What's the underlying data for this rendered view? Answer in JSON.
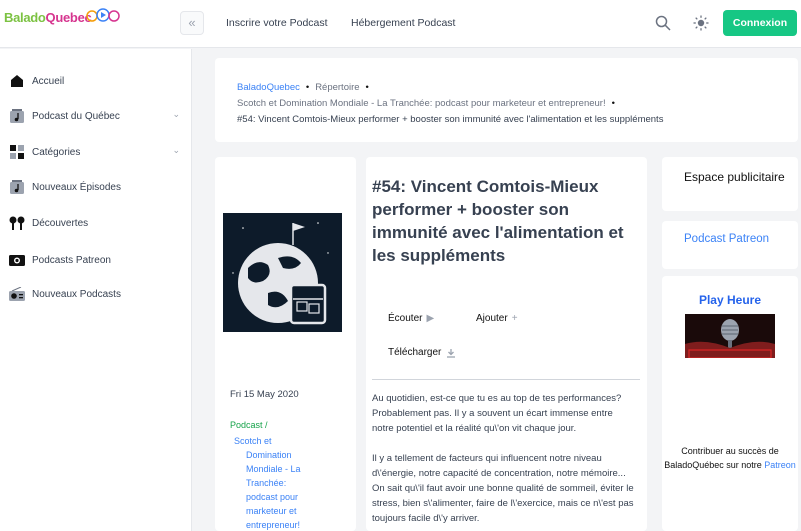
{
  "header": {
    "logo_part1": "Balado",
    "logo_part2": "Quebec",
    "nav_links": [
      "Inscrire votre Podcast",
      "Hébergement Podcast"
    ],
    "login_label": "Connexion"
  },
  "sidebar": {
    "items": [
      {
        "label": "Accueil",
        "icon": "home-icon"
      },
      {
        "label": "Podcast du Québec",
        "icon": "music-note-icon",
        "has_chevron": true
      },
      {
        "label": "Catégories",
        "icon": "grid-icon",
        "has_chevron": true
      },
      {
        "label": "Nouveaux Épisodes",
        "icon": "music-note-icon"
      },
      {
        "label": "Découvertes",
        "icon": "earbuds-icon"
      },
      {
        "label": "Podcasts Patreon",
        "icon": "camera-icon"
      },
      {
        "label": "Nouveaux Podcasts",
        "icon": "radio-icon"
      }
    ]
  },
  "breadcrumb": {
    "site": "BaladoQuebec",
    "directory": "Répertoire",
    "podcast": "Scotch et Domination Mondiale - La Tranchée: podcast pour marketeur et entrepreneur!",
    "episode": "#54: Vincent Comtois-Mieux performer + booster son immunité avec l'alimentation et les suppléments"
  },
  "episode": {
    "title": "#54: Vincent Comtois-Mieux performer + booster son immunité avec l'alimentation et les suppléments",
    "date": "Fri 15 May 2020",
    "podcast_label": "Podcast /",
    "podcast_name_lines": [
      "Scotch et",
      "Domination",
      "Mondiale - La",
      "Tranchée:",
      "podcast pour",
      "marketeur et",
      "entrepreneur!"
    ],
    "actions": {
      "listen": "Écouter",
      "add": "Ajouter",
      "download": "Télécharger"
    },
    "description": [
      "Au quotidien, est-ce que tu es au top de tes performances? Probablement pas. Il y a souvent un écart immense entre notre potentiel et la réalité qu\\'on vit chaque jour.",
      "Il y a tellement de facteurs qui influencent notre niveau d\\'énergie, notre capacité de concentration, notre mémoire... On sait qu\\'il faut avoir une bonne qualité de sommeil, éviter le stress, bien s\\'alimenter, faire de l\\'exercice, mais ce n\\'est pas toujours facile d\\'y arriver."
    ]
  },
  "right": {
    "ad_title": "Espace publicitaire",
    "patreon_title": "Podcast Patreon",
    "play_title": "Play Heure",
    "contrib_text": "Contribuer au succès de BaladoQuébec sur notre",
    "contrib_link": "Patreon"
  },
  "colors": {
    "accent_green": "#16c784",
    "link_blue": "#3b82f6",
    "logo_green": "#7cc242",
    "logo_pink": "#d6358f"
  }
}
